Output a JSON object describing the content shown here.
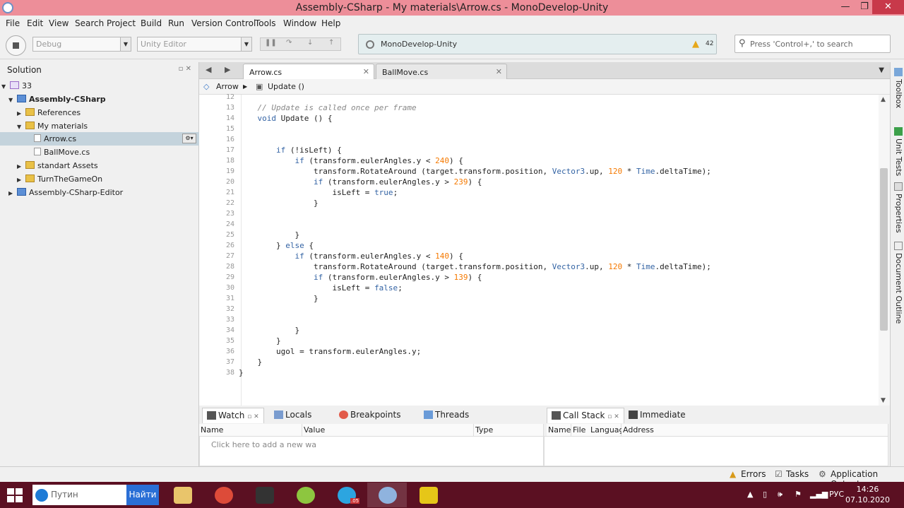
{
  "window": {
    "title": "Assembly-CSharp - My materials\\Arrow.cs - MonoDevelop-Unity"
  },
  "menu": [
    "File",
    "Edit",
    "View",
    "Search",
    "Project",
    "Build",
    "Run",
    "Version Control",
    "Tools",
    "Window",
    "Help"
  ],
  "toolbar": {
    "config": "Debug",
    "target": "Unity Editor",
    "status_text": "MonoDevelop-Unity",
    "warning_count": "42",
    "search_placeholder": "Press 'Control+,' to search"
  },
  "solution": {
    "header": "Solution",
    "items": [
      {
        "label": "33"
      },
      {
        "label": "Assembly-CSharp"
      },
      {
        "label": "References"
      },
      {
        "label": "My materials"
      },
      {
        "label": "Arrow.cs"
      },
      {
        "label": "BallMove.cs"
      },
      {
        "label": "standart Assets"
      },
      {
        "label": "TurnTheGameOn"
      },
      {
        "label": "Assembly-CSharp-Editor"
      }
    ]
  },
  "tabs": [
    {
      "label": "Arrow.cs"
    },
    {
      "label": "BallMove.cs"
    }
  ],
  "breadcrumb": {
    "class": "Arrow",
    "method": "Update ()"
  },
  "code": [
    {
      "n": "12",
      "t": ""
    },
    {
      "n": "13",
      "t": "    // Update is called once per frame"
    },
    {
      "n": "14",
      "t": "    void Update () {"
    },
    {
      "n": "15",
      "t": ""
    },
    {
      "n": "16",
      "t": ""
    },
    {
      "n": "17",
      "t": "        if (!isLeft) {"
    },
    {
      "n": "18",
      "t": "            if (transform.eulerAngles.y < 240) {"
    },
    {
      "n": "19",
      "t": "                transform.RotateAround (target.transform.position, Vector3.up, 120 * Time.deltaTime);"
    },
    {
      "n": "20",
      "t": "                if (transform.eulerAngles.y > 239) {"
    },
    {
      "n": "21",
      "t": "                    isLeft = true;"
    },
    {
      "n": "22",
      "t": "                }"
    },
    {
      "n": "23",
      "t": ""
    },
    {
      "n": "24",
      "t": ""
    },
    {
      "n": "25",
      "t": "            }"
    },
    {
      "n": "26",
      "t": "        } else {"
    },
    {
      "n": "27",
      "t": "            if (transform.eulerAngles.y < 140) {"
    },
    {
      "n": "28",
      "t": "                transform.RotateAround (target.transform.position, Vector3.up, 120 * Time.deltaTime);"
    },
    {
      "n": "29",
      "t": "                if (transform.eulerAngles.y > 139) {"
    },
    {
      "n": "30",
      "t": "                    isLeft = false;"
    },
    {
      "n": "31",
      "t": "                }"
    },
    {
      "n": "32",
      "t": ""
    },
    {
      "n": "33",
      "t": ""
    },
    {
      "n": "34",
      "t": "            }"
    },
    {
      "n": "35",
      "t": "        }"
    },
    {
      "n": "36",
      "t": "        ugol = transform.eulerAngles.y;"
    },
    {
      "n": "37",
      "t": "    }"
    },
    {
      "n": "38",
      "t": "}"
    }
  ],
  "bottom": {
    "tabs": {
      "watch": "Watch",
      "locals": "Locals",
      "breakpoints": "Breakpoints",
      "threads": "Threads",
      "callstack": "Call Stack",
      "immediate": "Immediate"
    },
    "watch_cols": {
      "name": "Name",
      "value": "Value",
      "type": "Type"
    },
    "watch_hint": "Click here to add a new wa",
    "call_cols": {
      "name": "Name",
      "file": "File",
      "language": "Language",
      "address": "Address"
    }
  },
  "right_pads": {
    "toolbox": "Toolbox",
    "unit_tests": "Unit Tests",
    "properties": "Properties",
    "document_outline": "Document Outline"
  },
  "statusbar": {
    "errors": "Errors",
    "tasks": "Tasks",
    "app_output": "Application Output"
  },
  "taskbar": {
    "search_text": "Путин",
    "search_button": "Найти",
    "lang": "РУС",
    "time": "14:26",
    "date": "07.10.2020",
    "badge": ".05"
  },
  "colors": {
    "titlebar": "#ed8e99",
    "taskbar": "#5b1022",
    "keyword": "#3363a4",
    "number": "#f57900",
    "comment": "#888888"
  }
}
